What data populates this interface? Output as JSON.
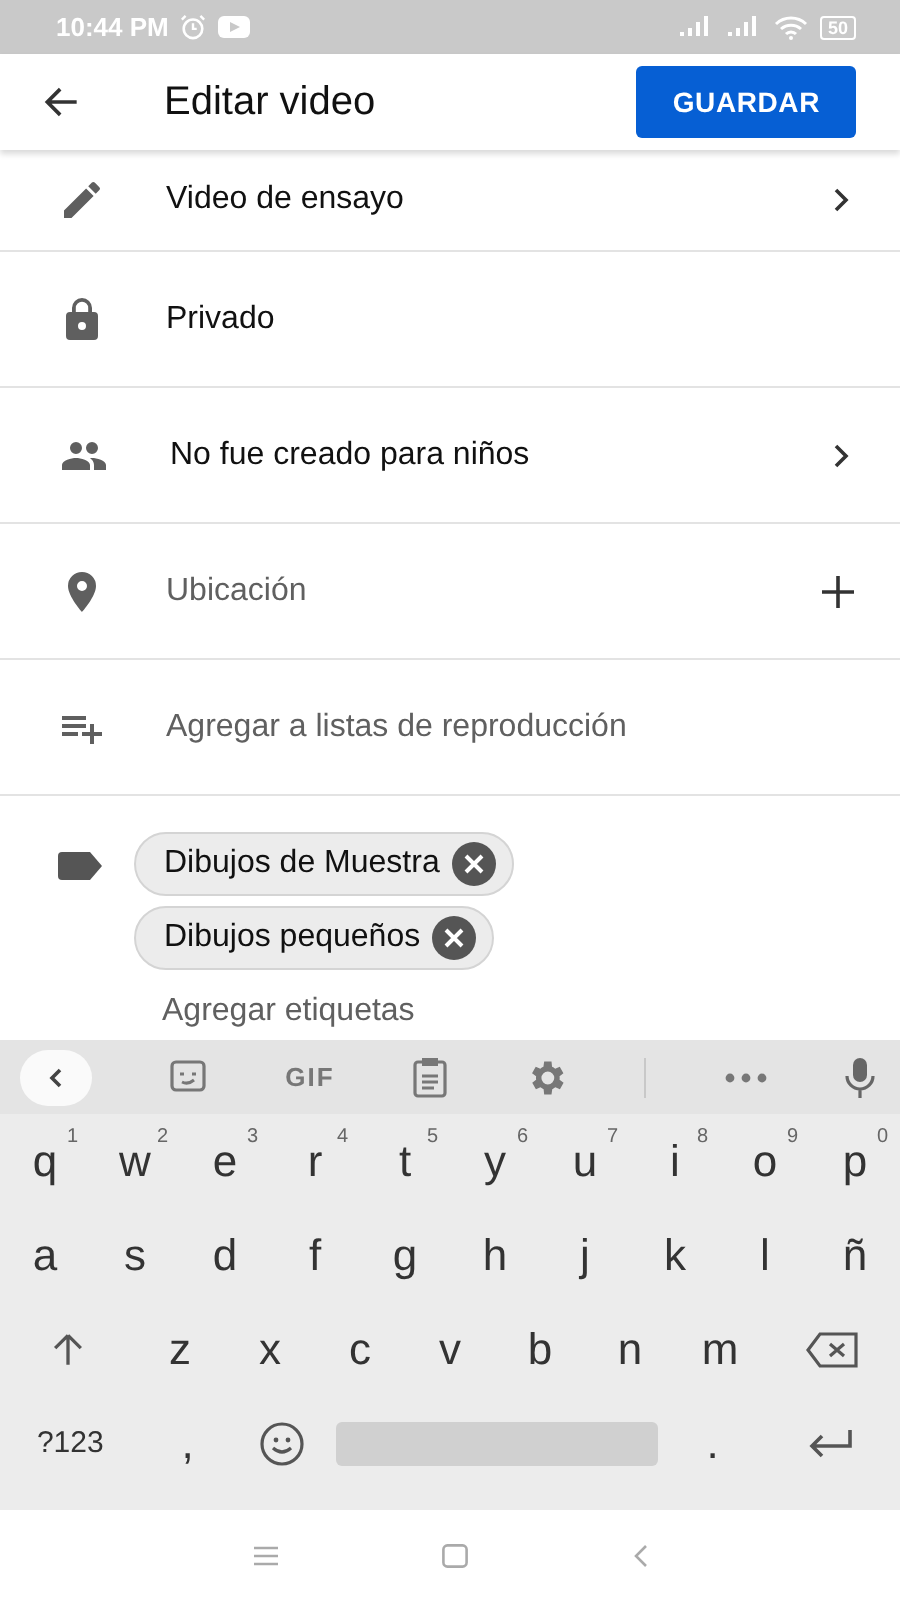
{
  "status_bar": {
    "time": "10:44 PM",
    "battery": "50"
  },
  "app_bar": {
    "title": "Editar video",
    "save_button": "GUARDAR"
  },
  "settings": [
    {
      "label": "Video de ensayo",
      "kind": "link",
      "hint": false
    },
    {
      "label": "Privado",
      "kind": "static",
      "hint": false
    },
    {
      "label": "No fue creado para niños",
      "kind": "link",
      "hint": false
    },
    {
      "label": "Ubicación",
      "kind": "add",
      "hint": true
    },
    {
      "label": "Agregar a listas de reproducción",
      "kind": "static",
      "hint": true
    }
  ],
  "tags": {
    "chips": [
      {
        "label": "Dibujos de Muestra"
      },
      {
        "label": "Dibujos pequeños"
      }
    ],
    "placeholder": "Agregar etiquetas"
  },
  "keyboard": {
    "toolbar_label": "GIF",
    "rows": [
      [
        {
          "kind": "char",
          "label": "q",
          "hint": "1"
        },
        {
          "kind": "char",
          "label": "w",
          "hint": "2"
        },
        {
          "kind": "char",
          "label": "e",
          "hint": "3"
        },
        {
          "kind": "char",
          "label": "r",
          "hint": "4"
        },
        {
          "kind": "char",
          "label": "t",
          "hint": "5"
        },
        {
          "kind": "char",
          "label": "y",
          "hint": "6"
        },
        {
          "kind": "char",
          "label": "u",
          "hint": "7"
        },
        {
          "kind": "char",
          "label": "i",
          "hint": "8"
        },
        {
          "kind": "char",
          "label": "o",
          "hint": "9"
        },
        {
          "kind": "char",
          "label": "p",
          "hint": "0"
        }
      ],
      [
        {
          "kind": "char",
          "label": "a"
        },
        {
          "kind": "char",
          "label": "s"
        },
        {
          "kind": "char",
          "label": "d"
        },
        {
          "kind": "char",
          "label": "f"
        },
        {
          "kind": "char",
          "label": "g"
        },
        {
          "kind": "char",
          "label": "h"
        },
        {
          "kind": "char",
          "label": "j"
        },
        {
          "kind": "char",
          "label": "k"
        },
        {
          "kind": "char",
          "label": "l"
        },
        {
          "kind": "char",
          "label": "ñ"
        }
      ],
      [
        {
          "kind": "shift"
        },
        {
          "kind": "char",
          "label": "z"
        },
        {
          "kind": "char",
          "label": "x"
        },
        {
          "kind": "char",
          "label": "c"
        },
        {
          "kind": "char",
          "label": "v"
        },
        {
          "kind": "char",
          "label": "b"
        },
        {
          "kind": "char",
          "label": "n"
        },
        {
          "kind": "char",
          "label": "m"
        },
        {
          "kind": "backspace"
        }
      ],
      [
        {
          "kind": "symbols",
          "label": "?123"
        },
        {
          "kind": "char",
          "label": ","
        },
        {
          "kind": "emoji"
        },
        {
          "kind": "space"
        },
        {
          "kind": "char",
          "label": "."
        },
        {
          "kind": "enter"
        }
      ]
    ]
  }
}
